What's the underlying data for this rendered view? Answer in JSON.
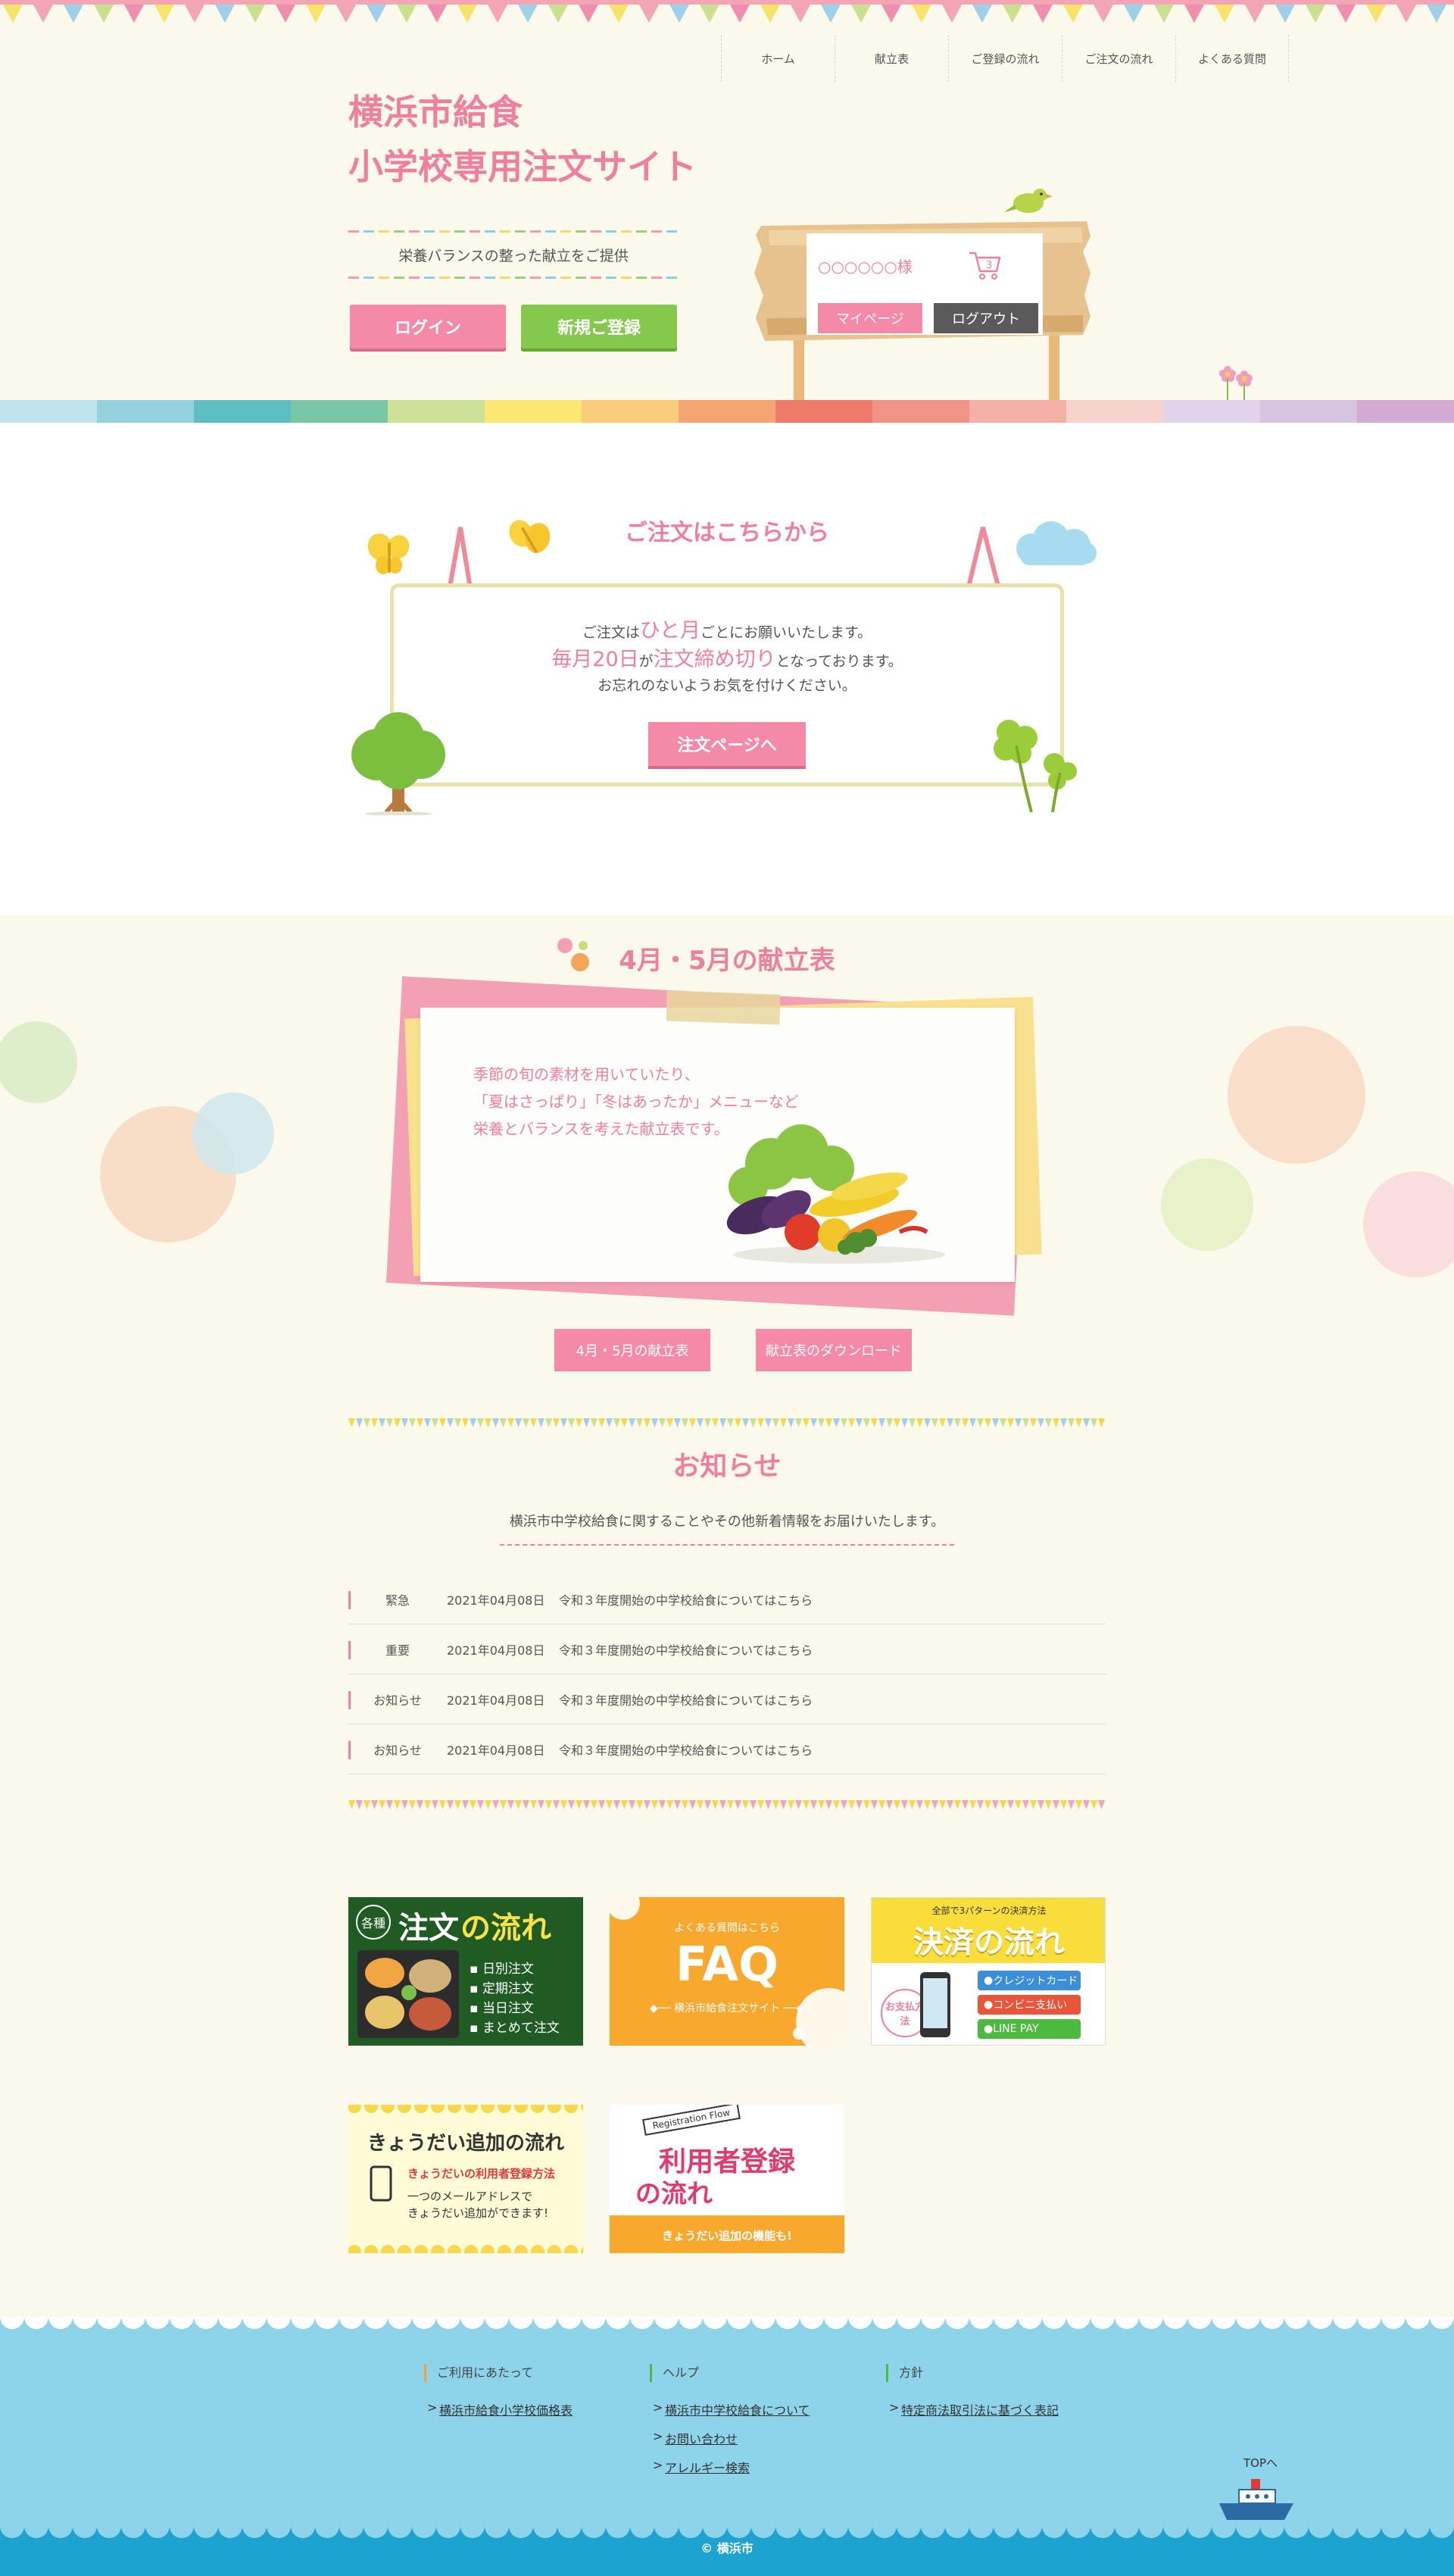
{
  "nav": {
    "items": [
      "ホーム",
      "献立表",
      "ご登録の流れ",
      "ご注文の流れ",
      "よくある質問"
    ]
  },
  "header": {
    "title_line1": "横浜市給食",
    "title_line2": "小学校専用注文サイト",
    "tagline": "栄養バランスの整った献立をご提供",
    "login_label": "ログイン",
    "register_label": "新規ご登録",
    "user_name": "○○○○○○様",
    "mypage_label": "マイページ",
    "logout_label": "ログアウト"
  },
  "order": {
    "title": "ご注文はこちらから",
    "line1_pre": "ご注文は",
    "line1_em": "ひと月",
    "line1_post": "ごとにお願いいたします。",
    "line2_em1": "毎月20日",
    "line2_mid": "が",
    "line2_em2": "注文締め切り",
    "line2_post": "となっております。",
    "line3": "お忘れのないようお気を付けください。",
    "button_label": "注文ページへ"
  },
  "menu": {
    "title": "4月・5月の献立表",
    "desc_line1": "季節の旬の素材を用いていたり、",
    "desc_line2": "「夏はさっぱり」「冬はあったか」メニューなど",
    "desc_line3": "栄養とバランスを考えた献立表です。",
    "button_menu": "4月・5月の献立表",
    "button_download": "献立表のダウンロード"
  },
  "news": {
    "title": "お知らせ",
    "subtitle": "横浜市中学校給食に関することやその他新着情報をお届けいたします。",
    "items": [
      {
        "category": "緊急",
        "date": "2021年04月08日",
        "text": "令和３年度開始の中学校給食についてはこちら"
      },
      {
        "category": "重要",
        "date": "2021年04月08日",
        "text": "令和３年度開始の中学校給食についてはこちら"
      },
      {
        "category": "お知らせ",
        "date": "2021年04月08日",
        "text": "令和３年度開始の中学校給食についてはこちら"
      },
      {
        "category": "お知らせ",
        "date": "2021年04月08日",
        "text": "令和３年度開始の中学校給食についてはこちら"
      }
    ]
  },
  "banners": {
    "order_flow": {
      "badge": "各種",
      "title_a": "注文",
      "title_b": "の流れ",
      "items": [
        "日別注文",
        "定期注文",
        "当日注文",
        "まとめて注文"
      ]
    },
    "faq": {
      "sub": "よくある質問はこちら",
      "title": "FAQ",
      "caption": "横浜市給食注文サイト"
    },
    "payment": {
      "top": "全部で3パターンの決済方法",
      "title": "決済の流れ",
      "badge": "お支払方法",
      "methods": [
        "クレジットカード",
        "コンビニ支払い",
        "LINE PAY"
      ]
    },
    "sibling": {
      "title": "きょうだい追加の流れ",
      "sub": "きょうだいの利用者登録方法",
      "desc1": "一つのメールアドレスで",
      "desc2": "きょうだい追加ができます!"
    },
    "registration": {
      "tag": "Registration Flow",
      "title1": "利用者登録",
      "title2": "の流れ",
      "bottom": "きょうだい追加の機能も!"
    }
  },
  "footer": {
    "col1": {
      "head": "ご利用にあたって",
      "links": [
        "横浜市給食小学校価格表"
      ]
    },
    "col2": {
      "head": "ヘルプ",
      "links": [
        "横浜市中学校給食について",
        "お問い合わせ",
        "アレルギー検索"
      ]
    },
    "col3": {
      "head": "方針",
      "links": [
        "特定商法取引法に基づく表記"
      ]
    },
    "top_label": "TOPへ",
    "copyright": "© 横浜市"
  },
  "colors": {
    "pink": "#f07f9d",
    "pink_button": "#f48aa8",
    "green_button": "#84c94d",
    "cream_bg": "#fbf9ec",
    "footer_blue": "#8dd3ea",
    "rainbow": [
      "#bfe4ef",
      "#95d1dc",
      "#5ebfc2",
      "#79c6a8",
      "#cde298",
      "#fbe872",
      "#f9cd7c",
      "#f4a571",
      "#ed7a6b",
      "#ef9487",
      "#f4b0a6",
      "#f5d3cc",
      "#e1d4ea",
      "#d7c4e0",
      "#d2aad3"
    ]
  },
  "icons": [
    "cart-icon",
    "tree-icon",
    "butterfly-icon",
    "cloud-icon",
    "clover-icon",
    "bird-icon",
    "flower-icon",
    "ship-icon",
    "vegetables-icon"
  ]
}
